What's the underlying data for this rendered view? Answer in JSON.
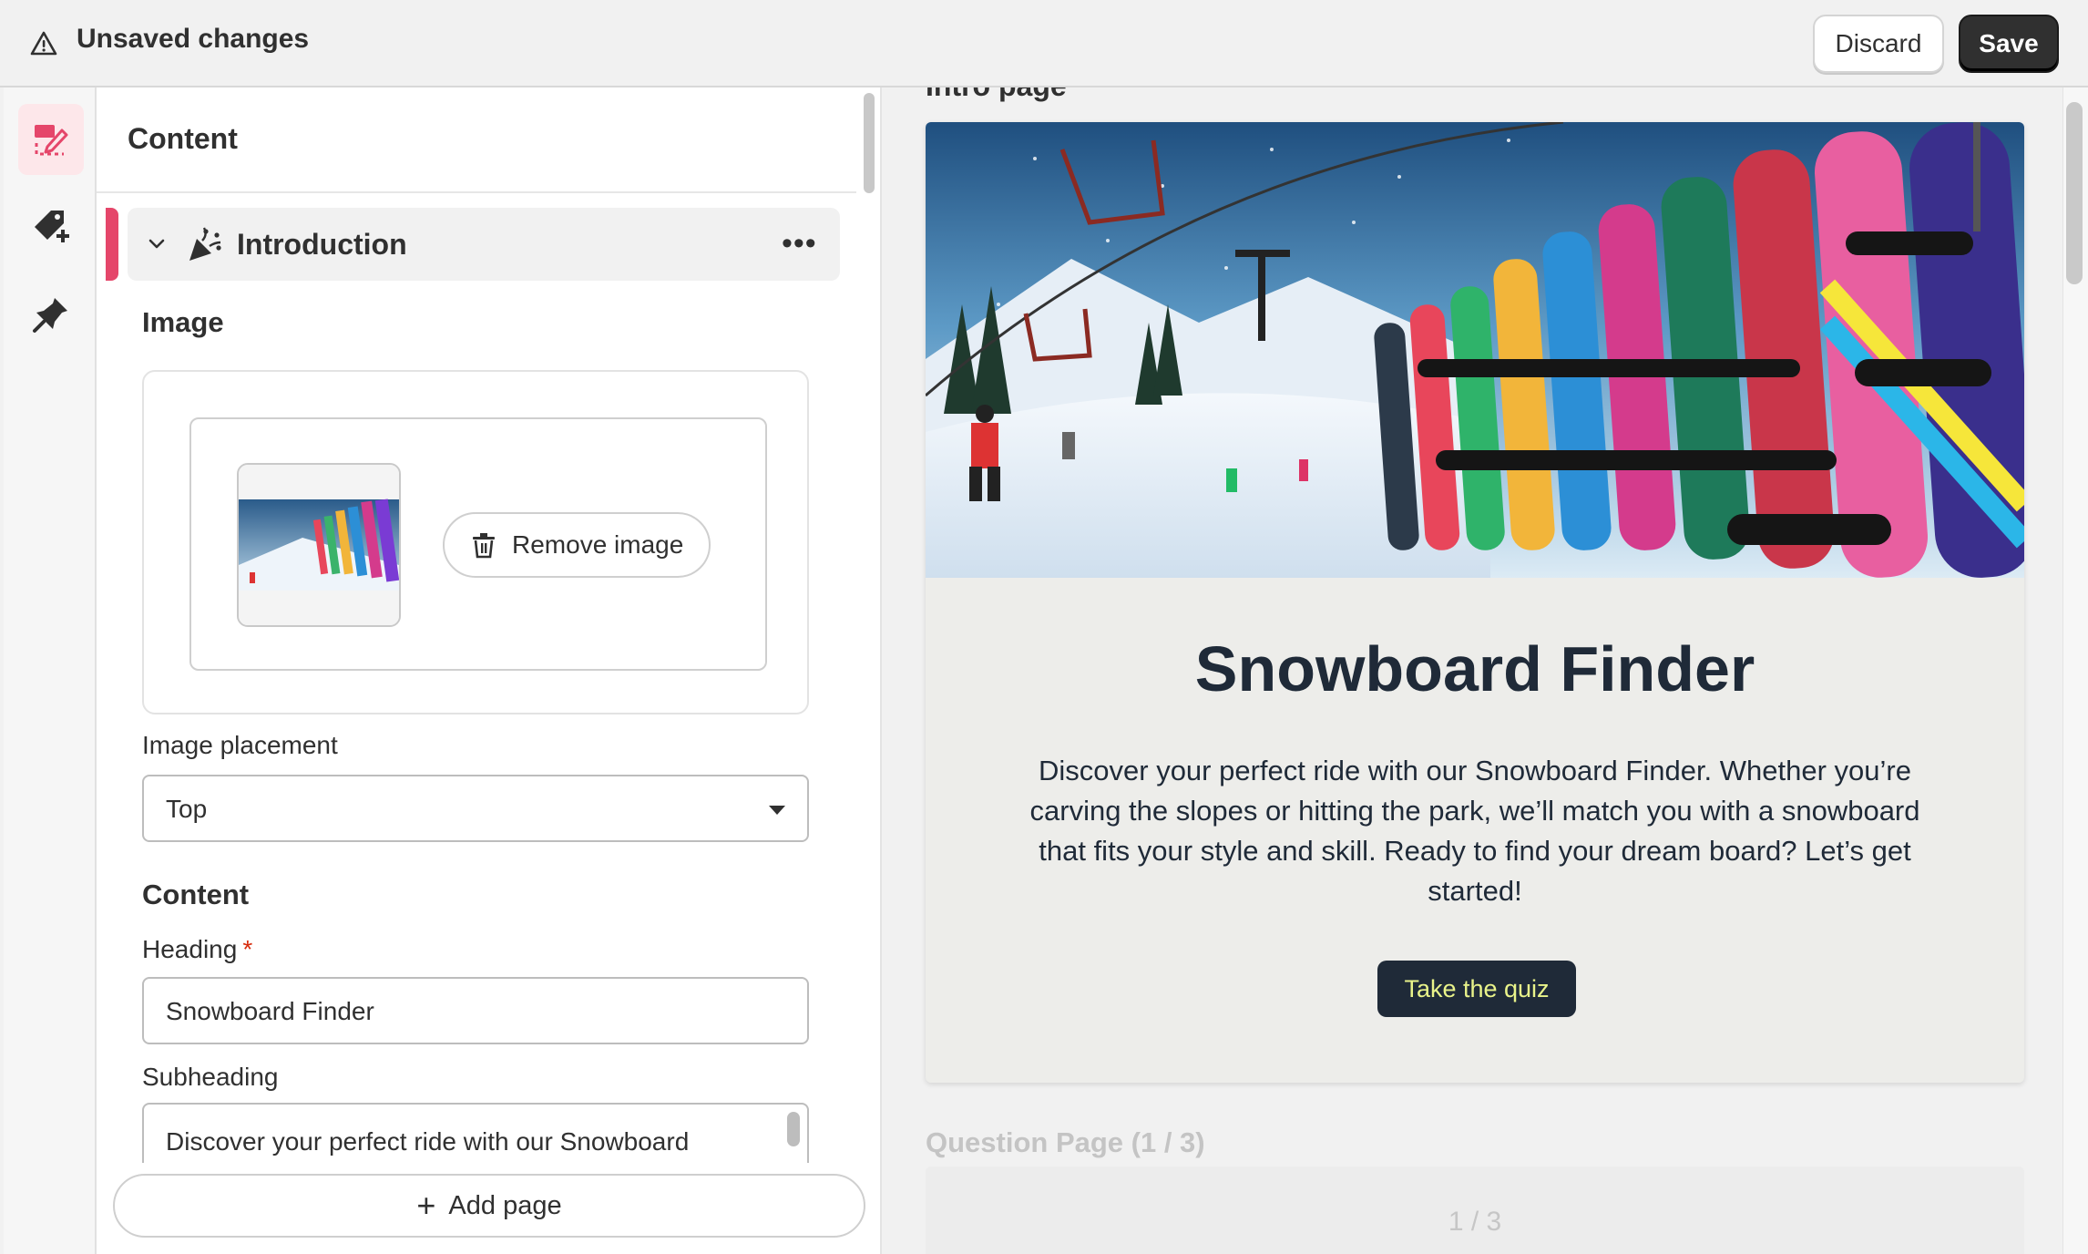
{
  "topbar": {
    "title": "Unsaved changes",
    "warning_icon": "warning-icon",
    "discard_label": "Discard",
    "save_label": "Save"
  },
  "rail": {
    "items": [
      {
        "name": "content-edit-icon",
        "active": true
      },
      {
        "name": "tag-add-icon",
        "active": false
      },
      {
        "name": "pin-icon",
        "active": false
      }
    ],
    "accent": "#e5466a"
  },
  "editor": {
    "title": "Content",
    "section": {
      "label": "Introduction",
      "more": "•••"
    },
    "image": {
      "label": "Image",
      "remove_label": "Remove image"
    },
    "placement": {
      "label": "Image placement",
      "value": "Top"
    },
    "content": {
      "label": "Content",
      "heading_label": "Heading",
      "required_mark": "*",
      "heading_value": "Snowboard Finder",
      "subheading_label": "Subheading",
      "subheading_value": "Discover your perfect ride with our Snowboard Finder. Whether you’re carving the slopes or hitting the park..."
    },
    "add_page_label": "Add page"
  },
  "preview": {
    "cut_label": "Intro page",
    "heading": "Snowboard Finder",
    "subheading": "Discover your perfect ride with our Snowboard Finder. Whether you’re carving the slopes or hitting the park, we’ll match you with a snowboard that fits your style and skill. Ready to find your dream board? Let’s get started!",
    "cta_label": "Take the quiz",
    "next_section_label": "Question Page (1 / 3)",
    "progress_label": "1 / 3",
    "colors": {
      "card_bg": "#ededea",
      "text": "#1f2a38",
      "cta_bg": "#1f2a38",
      "cta_text": "#e9f38a"
    }
  }
}
